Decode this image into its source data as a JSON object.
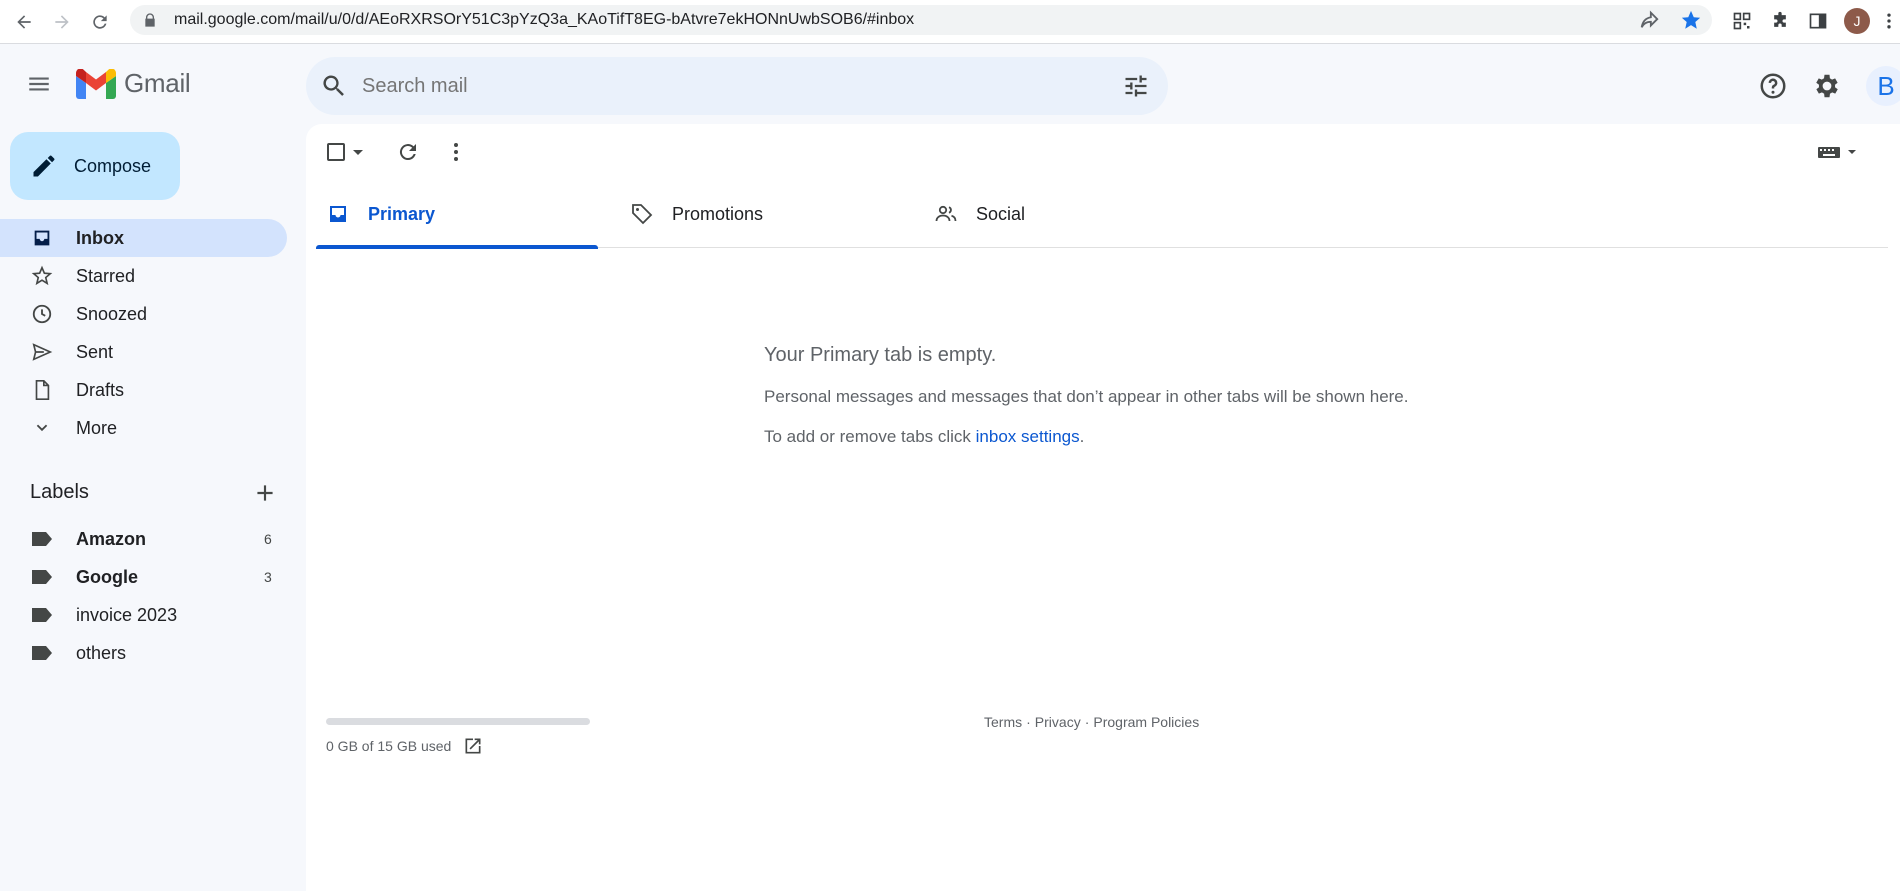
{
  "browser": {
    "url": "mail.google.com/mail/u/0/d/AEoRXRSOrY51C3pYzQ3a_KAoTifT8EG-bAtvre7ekHONnUwbSOB6/#inbox",
    "profile_initial": "J"
  },
  "header": {
    "app_name": "Gmail",
    "search_placeholder": "Search mail",
    "account_initial": "B"
  },
  "sidebar": {
    "compose_label": "Compose",
    "items": [
      {
        "label": "Inbox",
        "icon": "inbox-icon",
        "active": true
      },
      {
        "label": "Starred",
        "icon": "star-icon"
      },
      {
        "label": "Snoozed",
        "icon": "clock-icon"
      },
      {
        "label": "Sent",
        "icon": "send-icon"
      },
      {
        "label": "Drafts",
        "icon": "draft-icon"
      },
      {
        "label": "More",
        "icon": "chevron-down-icon"
      }
    ],
    "labels_title": "Labels",
    "labels": [
      {
        "name": "Amazon",
        "count": "6",
        "bold": true
      },
      {
        "name": "Google",
        "count": "3",
        "bold": true
      },
      {
        "name": "invoice 2023",
        "count": ""
      },
      {
        "name": "others",
        "count": ""
      }
    ]
  },
  "tabs": [
    {
      "label": "Primary",
      "icon": "inbox-icon",
      "active": true
    },
    {
      "label": "Promotions",
      "icon": "tag-icon"
    },
    {
      "label": "Social",
      "icon": "people-icon"
    }
  ],
  "empty_state": {
    "heading": "Your Primary tab is empty.",
    "line1": "Personal messages and messages that don’t appear in other tabs will be shown here.",
    "line2_prefix": "To add or remove tabs click ",
    "line2_link": "inbox settings",
    "line2_suffix": "."
  },
  "storage": {
    "text": "0 GB of 15 GB used",
    "used_fraction": 0
  },
  "footer": {
    "terms": "Terms",
    "privacy": "Privacy",
    "policies": "Program Policies",
    "separator": "·"
  },
  "colors": {
    "accent": "#0b57d0",
    "compose_bg": "#c2e7ff",
    "active_nav_bg": "#d3e3fd",
    "search_bg": "#eaf1fb"
  }
}
